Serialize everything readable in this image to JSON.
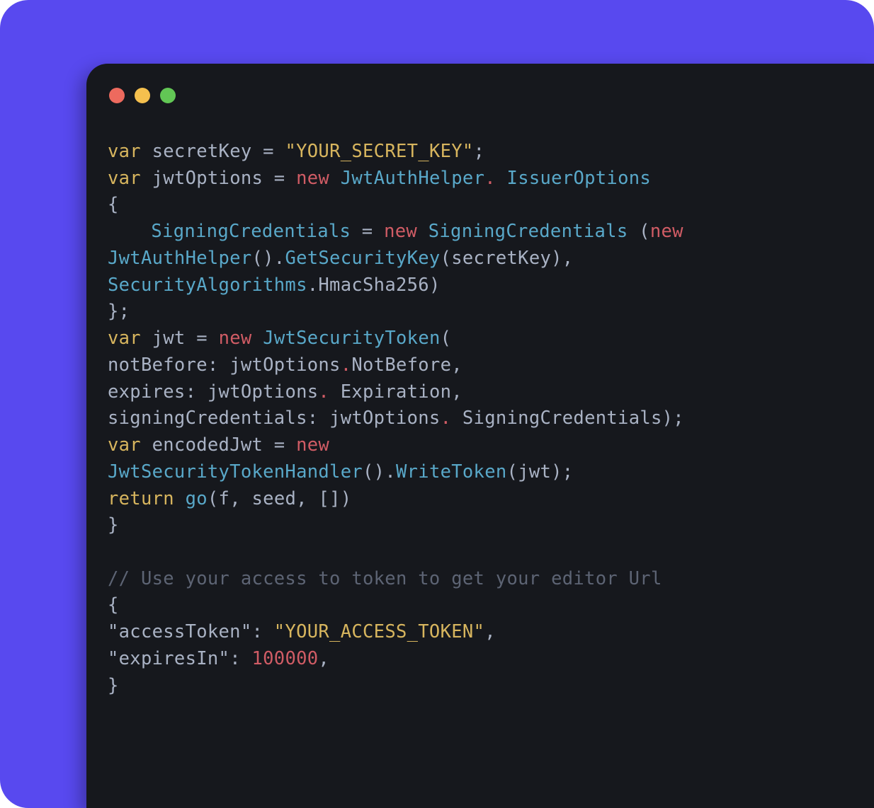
{
  "code": {
    "line1": {
      "kw": "var",
      "ident": "secretKey",
      "eq": " = ",
      "str": "\"YOUR_SECRET_KEY\"",
      "end": ";"
    },
    "line2": {
      "kw": "var",
      "ident": "jwtOptions",
      "eq": " = ",
      "new": "new",
      "type": "JwtAuthHelper",
      "dot": ".",
      "sp": " ",
      "type2": "IssuerOptions"
    },
    "line3": {
      "brace": "{"
    },
    "line4": {
      "prop": "SigningCredentials",
      "eq": " = ",
      "new": "new",
      "sp": " ",
      "type": "SigningCredentials",
      "sp2": " ",
      "paren": "(",
      "new2": "new"
    },
    "line5": {
      "type": "JwtAuthHelper",
      "parens": "()",
      "dot": ".",
      "method": "GetSecurityKey",
      "paren2": "(",
      "ident": "secretKey",
      "paren3": "),"
    },
    "line6": {
      "type": "SecurityAlgorithms",
      "dot": ".",
      "prop": "HmacSha256",
      "paren": ")"
    },
    "line7": {
      "brace": "};"
    },
    "line8": {
      "kw": "var",
      "ident": "jwt",
      "eq": " = ",
      "new": "new",
      "sp": " ",
      "type": "JwtSecurityToken",
      "paren": "("
    },
    "line9": {
      "label": "notBefore",
      "colon": ":",
      "sp": " ",
      "ident": "jwtOptions",
      "dot": ".",
      "prop": "NotBefore",
      "end": ","
    },
    "line10": {
      "label": "expires",
      "colon": ":",
      "sp": " ",
      "ident": "jwtOptions",
      "dot": ".",
      "sp2": " ",
      "prop": "Expiration",
      "end": ","
    },
    "line11": {
      "label": "signingCredentials",
      "colon": ":",
      "sp": " ",
      "ident": "jwtOptions",
      "dot": ".",
      "sp2": " ",
      "prop": "SigningCredentials",
      "end": ");"
    },
    "line12": {
      "kw": "var",
      "ident": "encodedJwt",
      "eq": " = ",
      "new": "new"
    },
    "line13": {
      "type": "JwtSecurityTokenHandler",
      "parens": "()",
      "dot": ".",
      "method": "WriteToken",
      "paren2": "(",
      "ident": "jwt",
      "paren3": ");"
    },
    "line14": {
      "kw": "return",
      "sp": " ",
      "fn": "go",
      "paren": "(",
      "a1": "f",
      "c1": ", ",
      "a2": "seed",
      "c2": ", ",
      "a3": "[]",
      "paren2": ")"
    },
    "line15": {
      "brace": "}"
    },
    "line16": {
      "blank": " "
    },
    "line17": {
      "comment": "// Use your access to token to get your editor Url"
    },
    "line18": {
      "brace": "{"
    },
    "line19": {
      "key": "\"accessToken\"",
      "colon": ": ",
      "val": "\"YOUR_ACCESS_TOKEN\"",
      "end": ","
    },
    "line20": {
      "key": "\"expiresIn\"",
      "colon": ": ",
      "val": "100000",
      "end": ","
    },
    "line21": {
      "brace": "}"
    }
  }
}
